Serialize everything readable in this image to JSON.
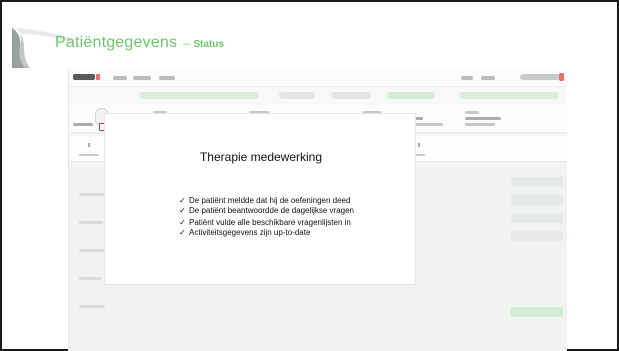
{
  "slide": {
    "title": "Patiëntgegevens",
    "separator": "–",
    "subtitle": "Status"
  },
  "panel": {
    "title": "Therapie medewerking",
    "items": [
      "De patiënt meldde dat hij de oefeningen deed",
      "De patiënt beantwoordde de dagelijkse vragen",
      "Patiënt vulde alle beschikbare vragenlijsten in",
      "Activiteitsgegevens zijn up-to-date"
    ],
    "check_symbol": "✓"
  },
  "colors": {
    "accent": "#6cc56e",
    "highlight": "#d9302f",
    "active_status": "#8fcf8a",
    "warning_status": "#f0ae58"
  },
  "icons": {
    "settings": "settings-icon",
    "logo": "app-logo-icon",
    "user": "user-avatar-icon"
  }
}
